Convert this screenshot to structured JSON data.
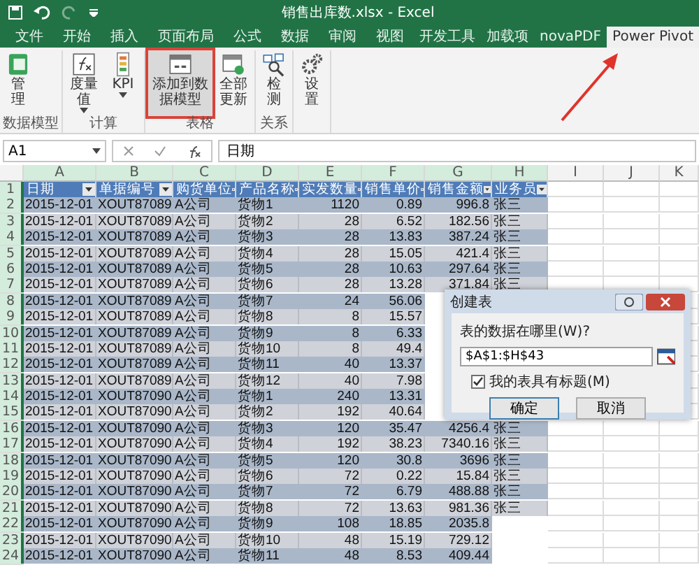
{
  "window": {
    "title": "销售出库数.xlsx - Excel"
  },
  "tabs": [
    {
      "label": "文件",
      "selected": false
    },
    {
      "label": "开始",
      "selected": false
    },
    {
      "label": "插入",
      "selected": false
    },
    {
      "label": "页面布局",
      "selected": false
    },
    {
      "label": "公式",
      "selected": false
    },
    {
      "label": "数据",
      "selected": false
    },
    {
      "label": "审阅",
      "selected": false
    },
    {
      "label": "视图",
      "selected": false
    },
    {
      "label": "开发工具",
      "selected": false
    },
    {
      "label": "加载项",
      "selected": false
    },
    {
      "label": "novaPDF",
      "selected": false
    },
    {
      "label": "Power Pivot",
      "selected": true
    }
  ],
  "ribbon": {
    "groups": [
      {
        "label": "数据模型",
        "buttons": [
          {
            "label": "管理",
            "kind": "manage",
            "dropdown": false,
            "highlighted": false
          }
        ]
      },
      {
        "label": "计算",
        "buttons": [
          {
            "label": "度量值",
            "kind": "measure",
            "dropdown": true,
            "highlighted": false
          },
          {
            "label": "KPI",
            "kind": "kpi",
            "dropdown": true,
            "highlighted": false
          }
        ]
      },
      {
        "label": "表格",
        "buttons": [
          {
            "label": "添加到数据模型",
            "kind": "addtable",
            "dropdown": false,
            "highlighted": true
          },
          {
            "label": "全部更新",
            "kind": "refresh",
            "dropdown": false,
            "highlighted": false
          }
        ]
      },
      {
        "label": "关系",
        "buttons": [
          {
            "label": "检测",
            "kind": "detect",
            "dropdown": false,
            "highlighted": false
          }
        ]
      },
      {
        "buttons": [
          {
            "label": "设置",
            "kind": "settings",
            "dropdown": false,
            "highlighted": false
          }
        ]
      }
    ]
  },
  "formula_bar": {
    "name_box": "A1",
    "formula": "日期"
  },
  "sheet": {
    "columns": [
      "A",
      "B",
      "C",
      "D",
      "E",
      "F",
      "G",
      "H",
      "I",
      "J",
      "K"
    ],
    "header_row": {
      "number": "1",
      "cells": [
        "日期",
        "单据编号",
        "购货单位",
        "产品名称",
        "实发数量",
        "销售单价",
        "销售金额",
        "业务员"
      ]
    },
    "rows": [
      {
        "number": "2",
        "cells": [
          "2015-12-01",
          "XOUT87089",
          "A公司",
          "货物1",
          "1120",
          "0.89",
          "996.8",
          "张三"
        ]
      },
      {
        "number": "3",
        "cells": [
          "2015-12-01",
          "XOUT87089",
          "A公司",
          "货物2",
          "28",
          "6.52",
          "182.56",
          "张三"
        ]
      },
      {
        "number": "4",
        "cells": [
          "2015-12-01",
          "XOUT87089",
          "A公司",
          "货物3",
          "28",
          "13.83",
          "387.24",
          "张三"
        ]
      },
      {
        "number": "5",
        "cells": [
          "2015-12-01",
          "XOUT87089",
          "A公司",
          "货物4",
          "28",
          "15.05",
          "421.4",
          "张三"
        ]
      },
      {
        "number": "6",
        "cells": [
          "2015-12-01",
          "XOUT87089",
          "A公司",
          "货物5",
          "28",
          "10.63",
          "297.64",
          "张三"
        ]
      },
      {
        "number": "7",
        "cells": [
          "2015-12-01",
          "XOUT87089",
          "A公司",
          "货物6",
          "28",
          "13.28",
          "371.84",
          "张三"
        ]
      },
      {
        "number": "8",
        "cells": [
          "2015-12-01",
          "XOUT87089",
          "A公司",
          "货物7",
          "24",
          "56.06"
        ]
      },
      {
        "number": "9",
        "cells": [
          "2015-12-01",
          "XOUT87089",
          "A公司",
          "货物8",
          "8",
          "15.57"
        ]
      },
      {
        "number": "10",
        "cells": [
          "2015-12-01",
          "XOUT87089",
          "A公司",
          "货物9",
          "8",
          "6.33"
        ]
      },
      {
        "number": "11",
        "cells": [
          "2015-12-01",
          "XOUT87089",
          "A公司",
          "货物10",
          "8",
          "49.4"
        ]
      },
      {
        "number": "12",
        "cells": [
          "2015-12-01",
          "XOUT87089",
          "A公司",
          "货物11",
          "40",
          "13.37"
        ]
      },
      {
        "number": "13",
        "cells": [
          "2015-12-01",
          "XOUT87089",
          "A公司",
          "货物12",
          "40",
          "7.98"
        ]
      },
      {
        "number": "14",
        "cells": [
          "2015-12-01",
          "XOUT87090",
          "A公司",
          "货物1",
          "240",
          "13.31"
        ]
      },
      {
        "number": "15",
        "cells": [
          "2015-12-01",
          "XOUT87090",
          "A公司",
          "货物2",
          "192",
          "40.64"
        ]
      },
      {
        "number": "16",
        "cells": [
          "2015-12-01",
          "XOUT87090",
          "A公司",
          "货物3",
          "120",
          "35.47",
          "4256.4",
          "张三"
        ]
      },
      {
        "number": "17",
        "cells": [
          "2015-12-01",
          "XOUT87090",
          "A公司",
          "货物4",
          "192",
          "38.23",
          "7340.16",
          "张三"
        ]
      },
      {
        "number": "18",
        "cells": [
          "2015-12-01",
          "XOUT87090",
          "A公司",
          "货物5",
          "120",
          "30.8",
          "3696",
          "张三"
        ]
      },
      {
        "number": "19",
        "cells": [
          "2015-12-01",
          "XOUT87090",
          "A公司",
          "货物6",
          "72",
          "0.22",
          "15.84",
          "张三"
        ]
      },
      {
        "number": "20",
        "cells": [
          "2015-12-01",
          "XOUT87090",
          "A公司",
          "货物7",
          "72",
          "6.79",
          "488.88",
          "张三"
        ]
      },
      {
        "number": "21",
        "cells": [
          "2015-12-01",
          "XOUT87090",
          "A公司",
          "货物8",
          "72",
          "13.63",
          "981.36",
          "张三"
        ]
      },
      {
        "number": "22",
        "cells": [
          "2015-12-01",
          "XOUT87090",
          "A公司",
          "货物9",
          "108",
          "18.85",
          "2035.8"
        ]
      },
      {
        "number": "23",
        "cells": [
          "2015-12-01",
          "XOUT87090",
          "A公司",
          "货物10",
          "48",
          "15.19",
          "729.12"
        ]
      },
      {
        "number": "24",
        "cells": [
          "2015-12-01",
          "XOUT87090",
          "A公司",
          "货物11",
          "48",
          "8.53",
          "409.44"
        ]
      }
    ]
  },
  "dialog": {
    "title": "创建表",
    "prompt": "表的数据在哪里(W)?",
    "range": "$A$1:$H$43",
    "checkbox": {
      "label": "我的表具有标题(M)",
      "checked": true
    },
    "buttons": [
      "确定",
      "取消"
    ]
  }
}
